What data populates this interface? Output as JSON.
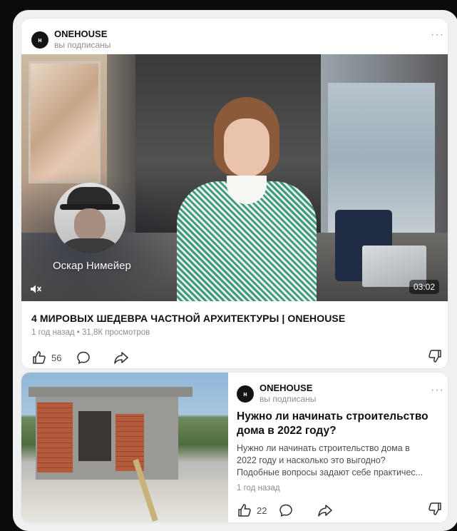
{
  "post1": {
    "channel": {
      "avatar_letter": "н",
      "name": "ONEHOUSE",
      "status": "вы подписаны"
    },
    "more": "···",
    "video": {
      "overlay_caption": "Оскар Нимейер",
      "duration": "03:02"
    },
    "title": "4 МИРОВЫХ ШЕДЕВРА ЧАСТНОЙ АРХИТЕКТУРЫ | ONEHOUSE",
    "meta": "1 год назад • 31,8К просмотров",
    "likes": "56"
  },
  "post2": {
    "channel": {
      "avatar_letter": "н",
      "name": "ONEHOUSE",
      "status": "вы подписаны"
    },
    "more": "···",
    "title_lines": [
      "Нужно ли начинать строительство",
      "дома в 2022 году?"
    ],
    "desc_lines": [
      "Нужно ли начинать строительство дома в",
      "2022 году и насколько это выгодно?",
      "Подобные вопросы задают себе практичес..."
    ],
    "time": "1 год назад",
    "likes": "22"
  },
  "icons": [
    "like-icon",
    "comment-icon",
    "share-icon",
    "dislike-icon",
    "mute-icon"
  ],
  "colors": {
    "background": "#eef0f2",
    "card": "#ffffff",
    "text": "#111111",
    "secondary": "#8a8e94"
  }
}
